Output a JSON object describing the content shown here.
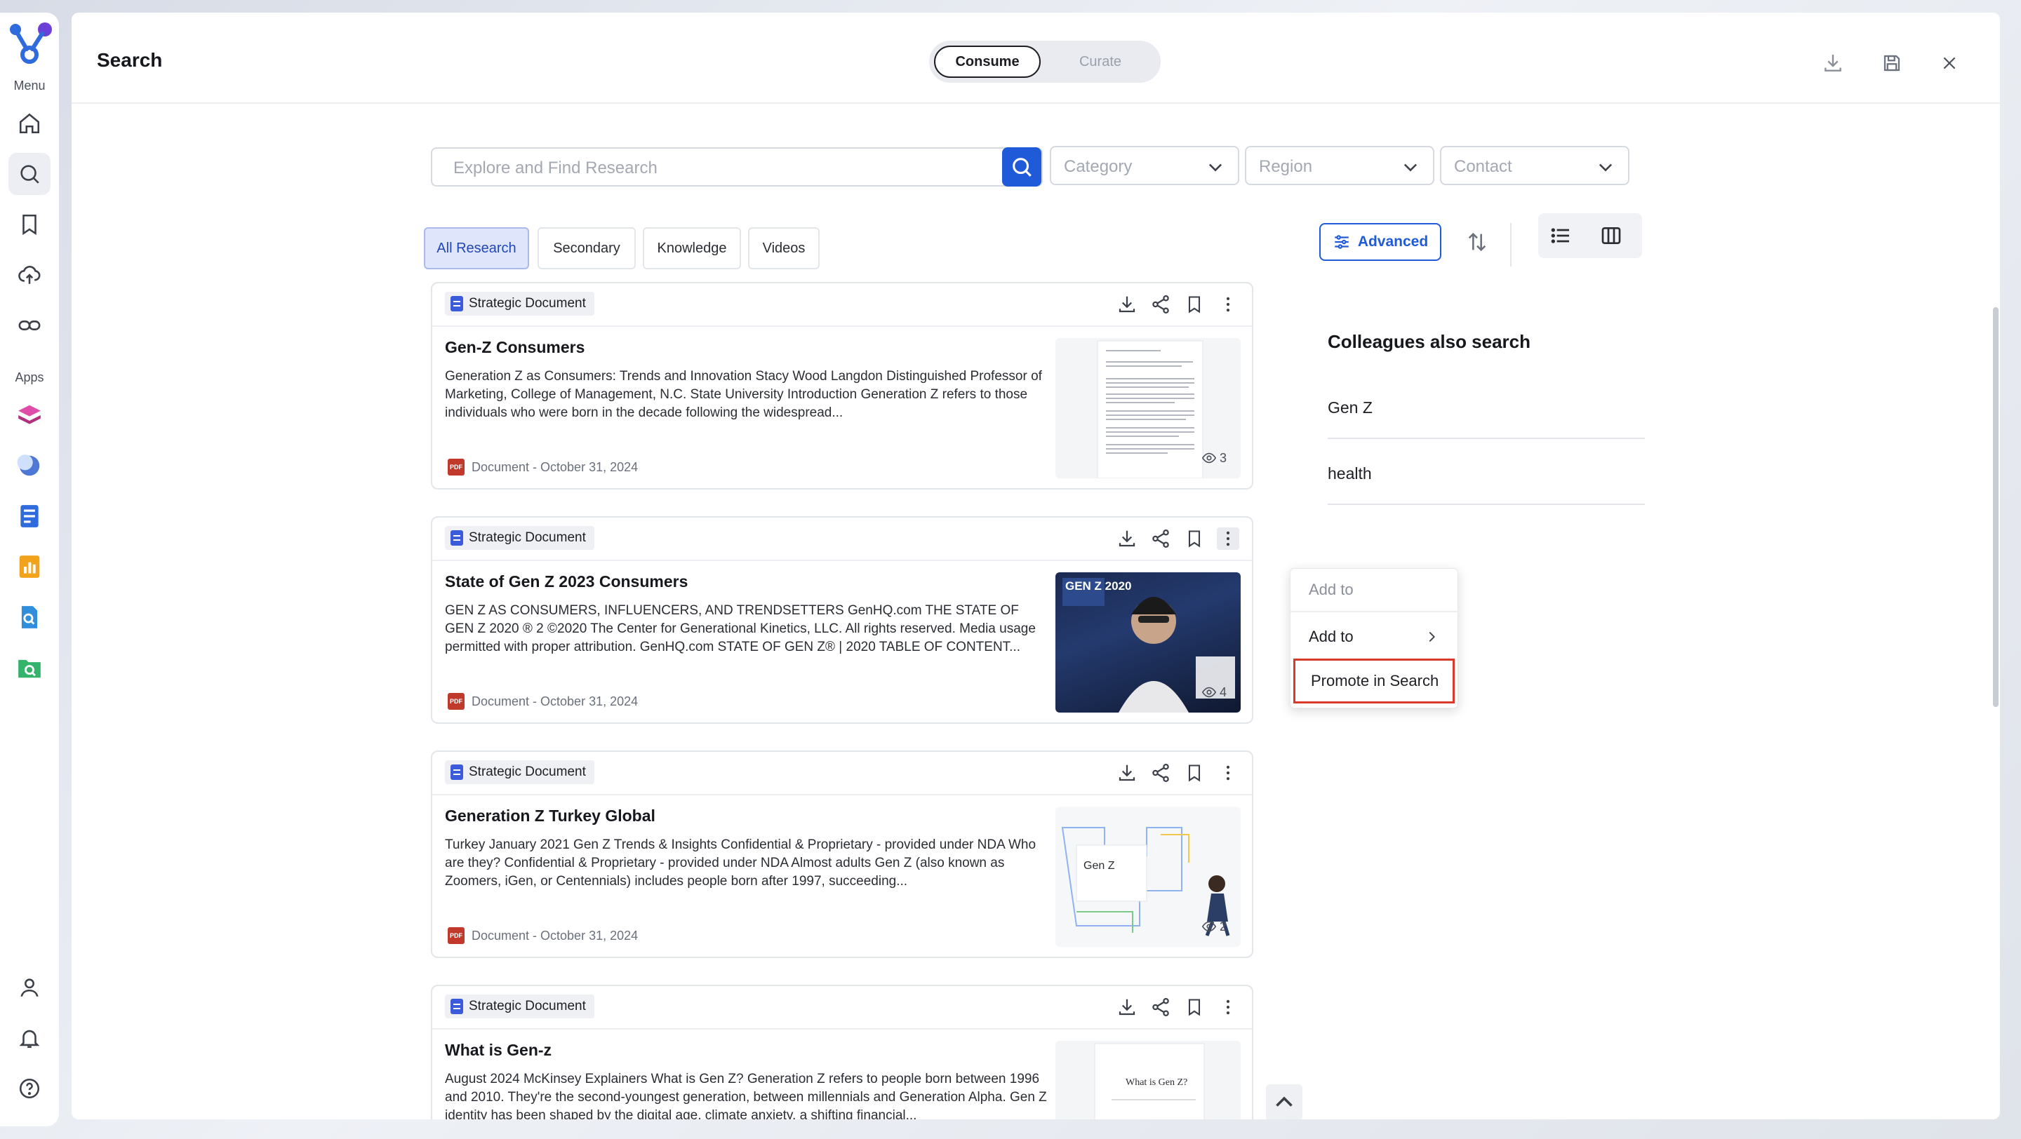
{
  "rail": {
    "menu_label": "Menu",
    "apps_label": "Apps",
    "items": [
      {
        "icon": "home-icon"
      },
      {
        "icon": "search-icon",
        "active": true
      },
      {
        "icon": "bookmark-icon"
      },
      {
        "icon": "upload-icon"
      },
      {
        "icon": "link-icon"
      }
    ],
    "apps": [
      {
        "icon": "stack-app-icon",
        "color": "#d63fa0"
      },
      {
        "icon": "moon-app-icon",
        "color": "#4f78d6"
      },
      {
        "icon": "form-app-icon",
        "color": "#2f6bdc"
      },
      {
        "icon": "chart-app-icon",
        "color": "#f2a31b"
      },
      {
        "icon": "doc-search-app-icon",
        "color": "#2f8fdc"
      },
      {
        "icon": "folder-search-app-icon",
        "color": "#34b36a"
      }
    ],
    "bottom": [
      {
        "icon": "user-icon"
      },
      {
        "icon": "bell-icon"
      },
      {
        "icon": "help-icon"
      }
    ]
  },
  "header": {
    "title": "Search",
    "mode": {
      "active": "Consume",
      "inactive": "Curate"
    }
  },
  "search": {
    "placeholder": "Explore and Find Research",
    "filters": [
      "Category",
      "Region",
      "Contact"
    ]
  },
  "tabs": [
    "All Research",
    "Secondary",
    "Knowledge",
    "Videos"
  ],
  "toolbar": {
    "advanced_label": "Advanced"
  },
  "results": [
    {
      "type": "Strategic Document",
      "title": "Gen-Z Consumers",
      "description": "Generation Z as Consumers: Trends and Innovation Stacy Wood Langdon Distinguished Professor of Marketing, College of Management, N.C. State University Introduction Generation Z refers to those individuals who were born in the decade following the widespread...",
      "meta": "Document - October 31, 2024",
      "views": "3"
    },
    {
      "type": "Strategic Document",
      "title": "State of Gen Z 2023 Consumers",
      "description": "GEN Z AS CONSUMERS, INFLUENCERS, AND TRENDSETTERS GenHQ.com THE STATE OF GEN Z 2020 ® 2 ©2020 The Center for Generational Kinetics, LLC. All rights reserved. Media usage permitted with proper attribution. GenHQ.com STATE OF GEN Z® | 2020 TABLE OF CONTENT...",
      "meta": "Document - October 31, 2024",
      "views": "4",
      "thumb_caption": "GEN Z 2020"
    },
    {
      "type": "Strategic Document",
      "title": "Generation Z Turkey Global",
      "description": "Turkey January 2021 Gen Z Trends & Insights Confidential & Proprietary - provided under NDA Who are they? Confidential & Proprietary - provided under NDA Almost adults Gen Z (also known as Zoomers, iGen, or Centennials) includes people born after 1997, succeeding...",
      "meta": "Document - October 31, 2024",
      "views": "2",
      "thumb_caption": "Gen Z"
    },
    {
      "type": "Strategic Document",
      "title": "What is Gen-z",
      "description": "August 2024 McKinsey Explainers What is Gen Z? Generation Z refers to people born between 1996 and 2010. They're the second-youngest generation, between millennials and Generation Alpha. Gen Z identity has been shaped by the digital age, climate anxiety, a shifting financial...",
      "meta": "Document - October 31, 2024",
      "views": "",
      "thumb_caption": "What is Gen Z?"
    }
  ],
  "context_menu": {
    "header": "Add to",
    "item_add": "Add to",
    "item_promote": "Promote in Search"
  },
  "colleagues": {
    "title": "Colleagues also search",
    "items": [
      "Gen Z",
      "health"
    ]
  },
  "colors": {
    "accent": "#1f5bd8",
    "highlight": "#d93a2b",
    "tab_active_bg": "#dfe6fb"
  }
}
